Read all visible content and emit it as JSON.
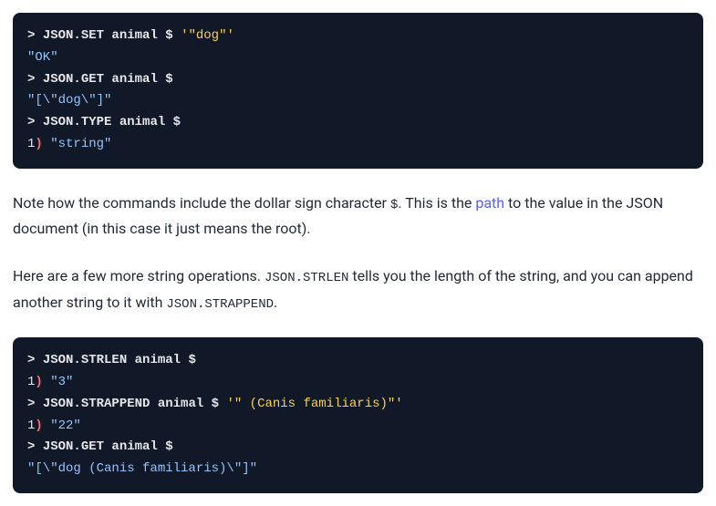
{
  "block1": {
    "l1_prompt": "> ",
    "l1_cmd": "JSON.SET",
    "l1_key": " animal ",
    "l1_dollar": "$",
    "l1_sp": " ",
    "l1_arg": "'\"dog\"'",
    "l2_out": "\"OK\"",
    "l3_prompt": "> ",
    "l3_cmd": "JSON.GET",
    "l3_key": " animal ",
    "l3_dollar": "$",
    "l4_out": "\"[\\\"dog\\\"]\"",
    "l5_prompt": "> ",
    "l5_cmd": "JSON.TYPE",
    "l5_key": " animal ",
    "l5_dollar": "$",
    "l6_idx_n": "1",
    "l6_idx_p": ")",
    "l6_sp": " ",
    "l6_out": "\"string\""
  },
  "para1": {
    "t1": "Note how the commands include the dollar sign character ",
    "code1": "$",
    "t2": ". This is the ",
    "link": "path",
    "t3": " to the value in the JSON document (in this case it just means the root)."
  },
  "para2": {
    "t1": "Here are a few more string operations. ",
    "code1": "JSON.STRLEN",
    "t2": " tells you the length of the string, and you can append another string to it with ",
    "code2": "JSON.STRAPPEND",
    "t3": "."
  },
  "block2": {
    "l1_prompt": "> ",
    "l1_cmd": "JSON.STRLEN",
    "l1_key": " animal ",
    "l1_dollar": "$",
    "l2_idx_n": "1",
    "l2_idx_p": ")",
    "l2_sp": " ",
    "l2_out": "\"3\"",
    "l3_prompt": "> ",
    "l3_cmd": "JSON.STRAPPEND",
    "l3_key": " animal ",
    "l3_dollar": "$",
    "l3_sp": " ",
    "l3_arg": "'\" (Canis familiaris)\"'",
    "l4_idx_n": "1",
    "l4_idx_p": ")",
    "l4_sp": " ",
    "l4_out": "\"22\"",
    "l5_prompt": "> ",
    "l5_cmd": "JSON.GET",
    "l5_key": " animal ",
    "l5_dollar": "$",
    "l6_out": "\"[\\\"dog (Canis familiaris)\\\"]\""
  }
}
